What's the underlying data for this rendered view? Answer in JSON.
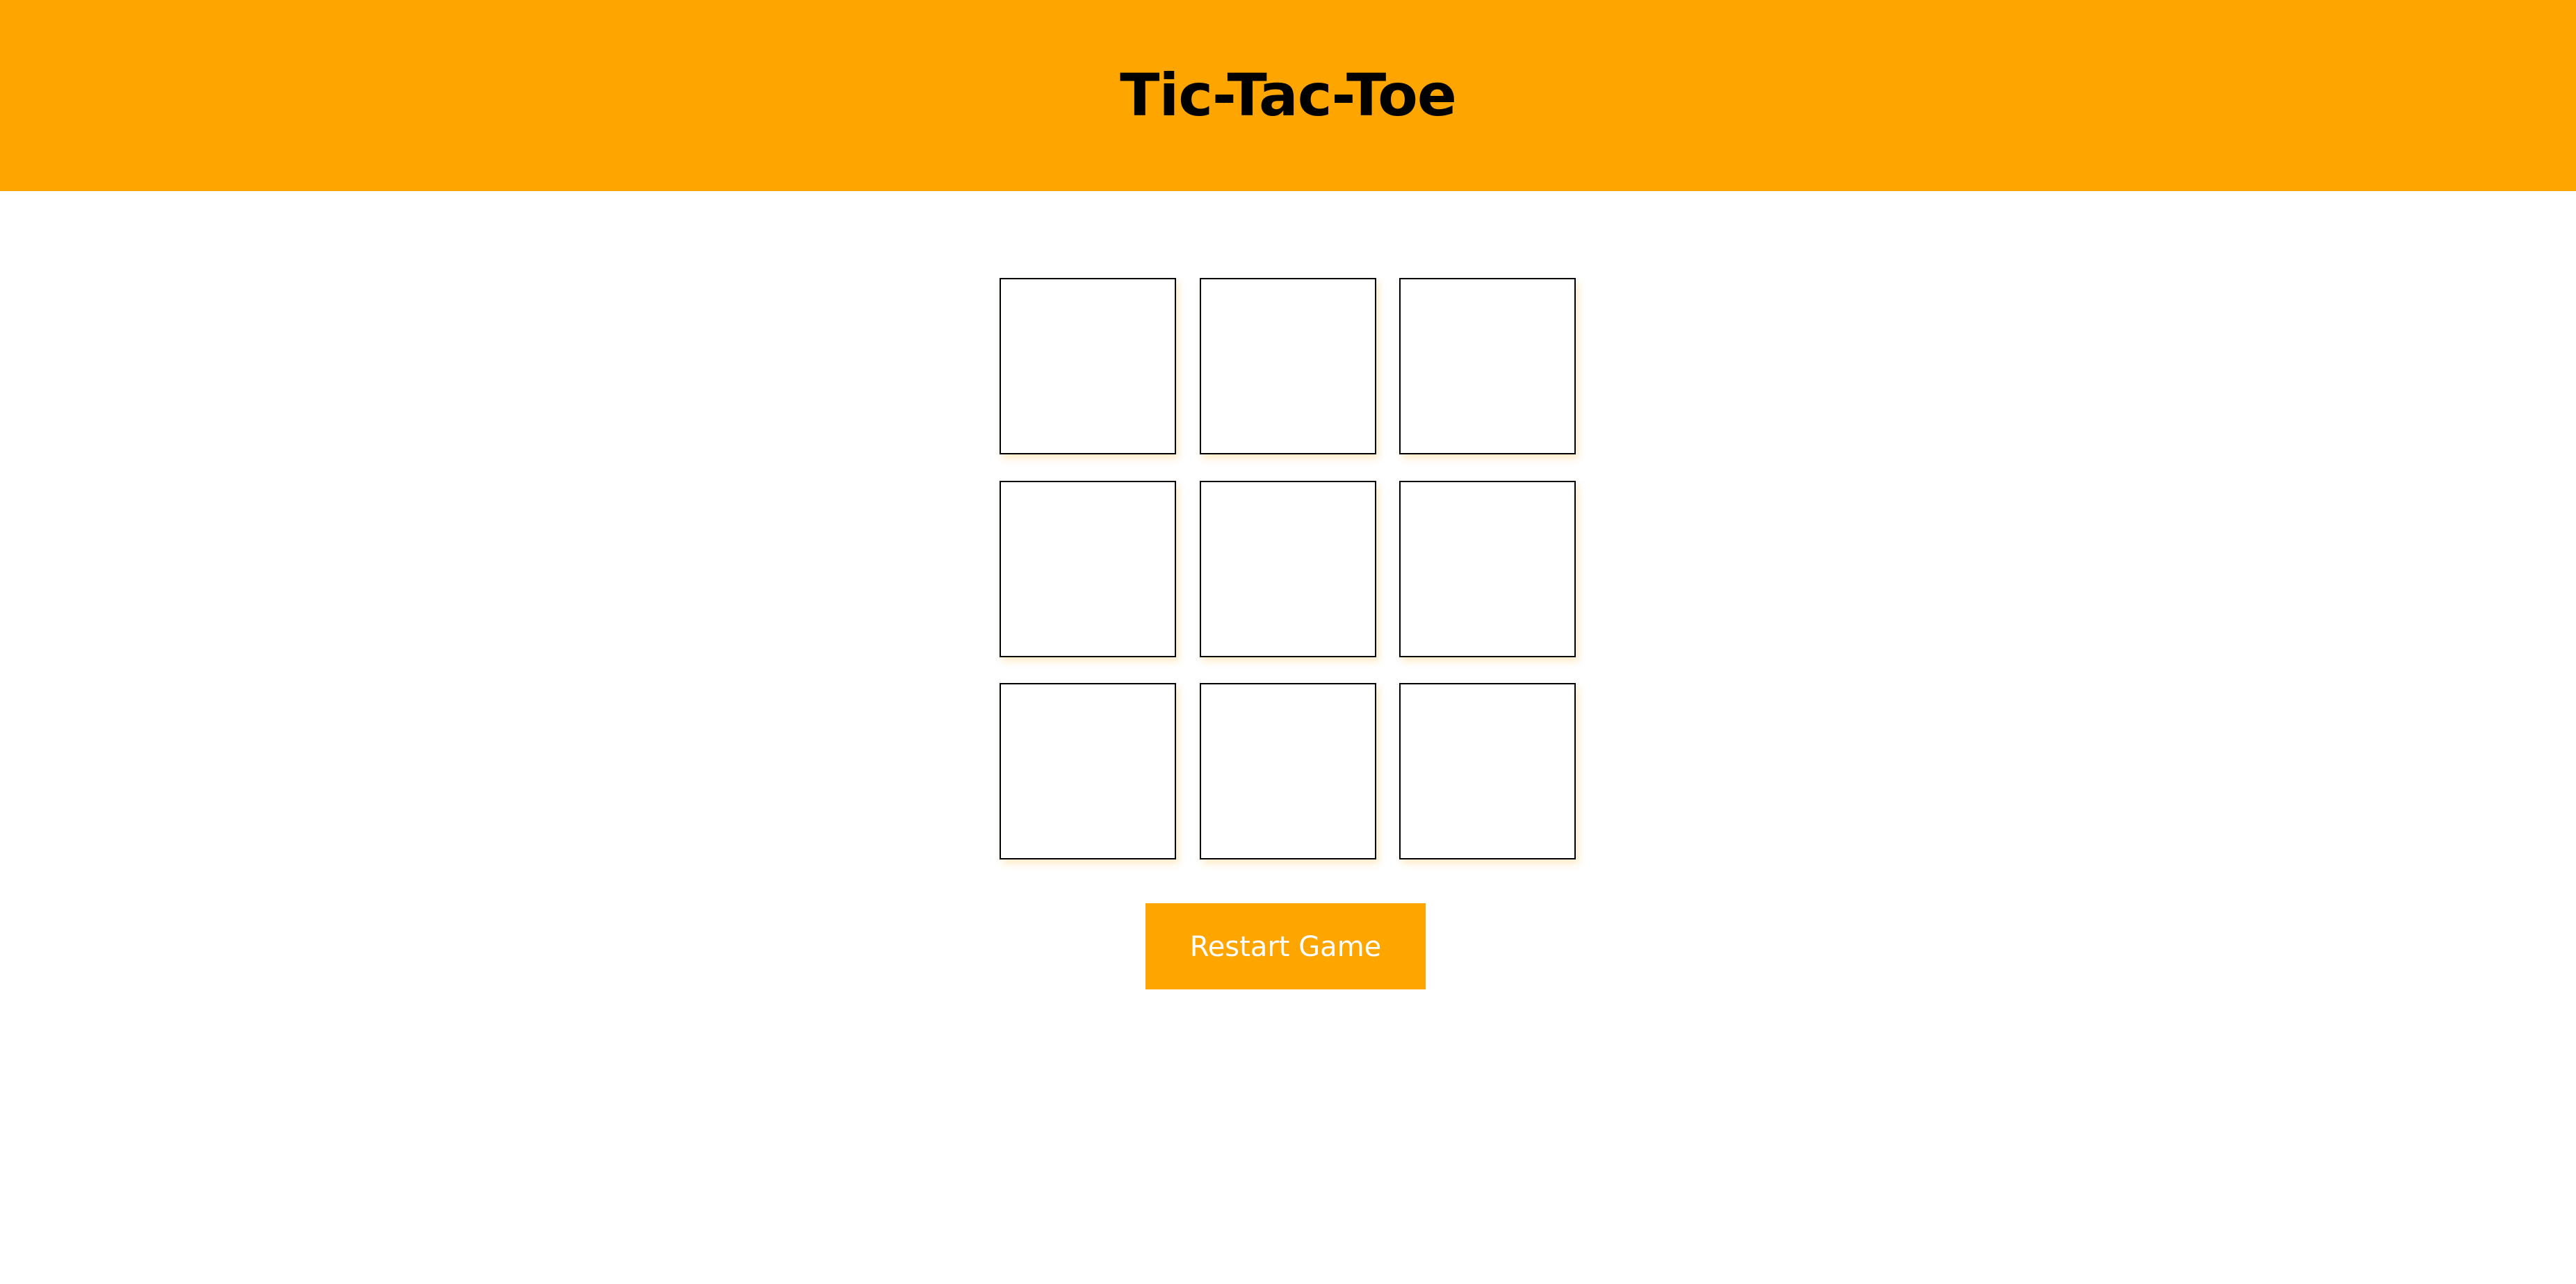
{
  "header": {
    "title": "Tic-Tac-Toe",
    "background": "#ffa500"
  },
  "board": {
    "cells": [
      {
        "value": ""
      },
      {
        "value": ""
      },
      {
        "value": ""
      },
      {
        "value": ""
      },
      {
        "value": ""
      },
      {
        "value": ""
      },
      {
        "value": ""
      },
      {
        "value": ""
      },
      {
        "value": ""
      }
    ]
  },
  "controls": {
    "restart_label": "Restart Game",
    "accent": "#ffa500"
  }
}
